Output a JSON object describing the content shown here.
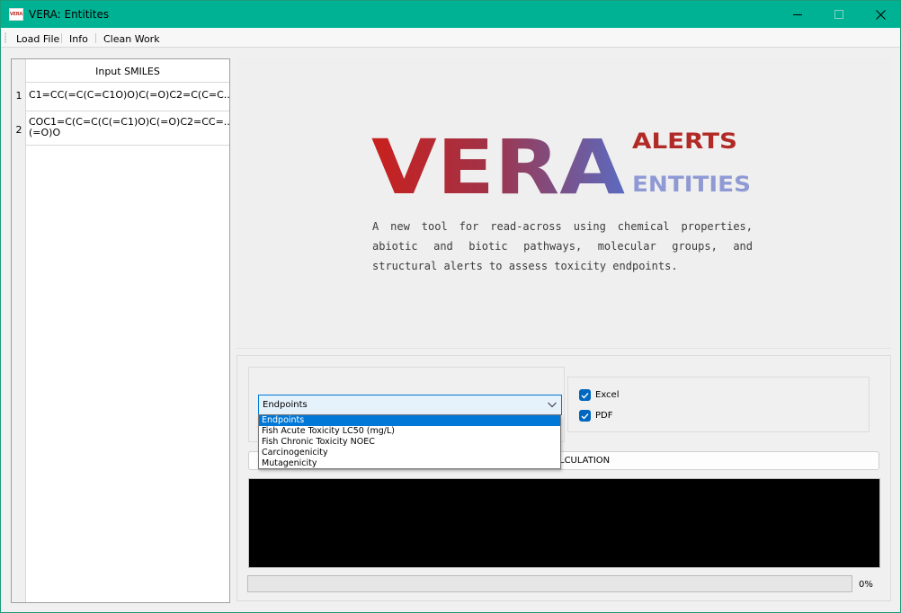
{
  "window": {
    "title": "VERA: Entitites",
    "icon_text": "VERA",
    "accent_color": "#00b294"
  },
  "menu": {
    "items": [
      {
        "label": "Load File"
      },
      {
        "label": "Info"
      },
      {
        "label": "Clean Work"
      }
    ]
  },
  "smiles_table": {
    "header": "Input SMILES",
    "rows": [
      {
        "num": "1",
        "value": "C1=CC(=C(C=C1O)O)C(=O)C2=C(C=C..."
      },
      {
        "num": "2",
        "value_line1": "COC1=C(C=C(C(=C1)O)C(=O)C2=CC=...",
        "value_line2": "(=O)O"
      }
    ]
  },
  "banner": {
    "logo_main": "VERA",
    "logo_alerts": "ALERTS",
    "logo_entities": "ENTITIES",
    "tagline": "A new tool for read-across using chemical properties, abiotic and biotic pathways, molecular groups, and structural alerts to assess toxicity endpoints.",
    "colors": {
      "red": "#c9201d",
      "blue": "#5b6bc0",
      "light_blue": "#8f9ad4"
    }
  },
  "controls": {
    "combo_value": "Endpoints",
    "dropdown_options": [
      "Endpoints",
      "Fish Acute Toxicity LC50 (mg/L)",
      "Fish Chronic Toxicity NOEC",
      "Carcinogenicity",
      "Mutagenicity"
    ],
    "selected_option_index": 0,
    "excel_label": "Excel",
    "excel_checked": true,
    "pdf_label": "PDF",
    "pdf_checked": true,
    "calc_button_label": "LCULATION",
    "progress_value": 0,
    "progress_text": "0%"
  }
}
